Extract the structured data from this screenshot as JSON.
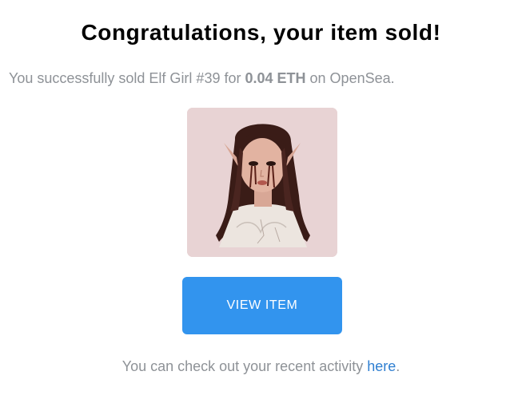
{
  "header": {
    "title": "Congratulations, your item sold!"
  },
  "message": {
    "prefix": "You successfully sold Elf Girl #39 for ",
    "amount": "0.04 ETH",
    "suffix": " on OpenSea."
  },
  "item": {
    "image_alt": "Elf Girl #39",
    "image_icon": "elf-girl-illustration",
    "background_color": "#e8d3d4"
  },
  "button": {
    "label": "VIEW ITEM",
    "color": "#3294ee"
  },
  "footer": {
    "prefix": "You can check out your recent activity ",
    "link_label": "here",
    "suffix": "."
  }
}
